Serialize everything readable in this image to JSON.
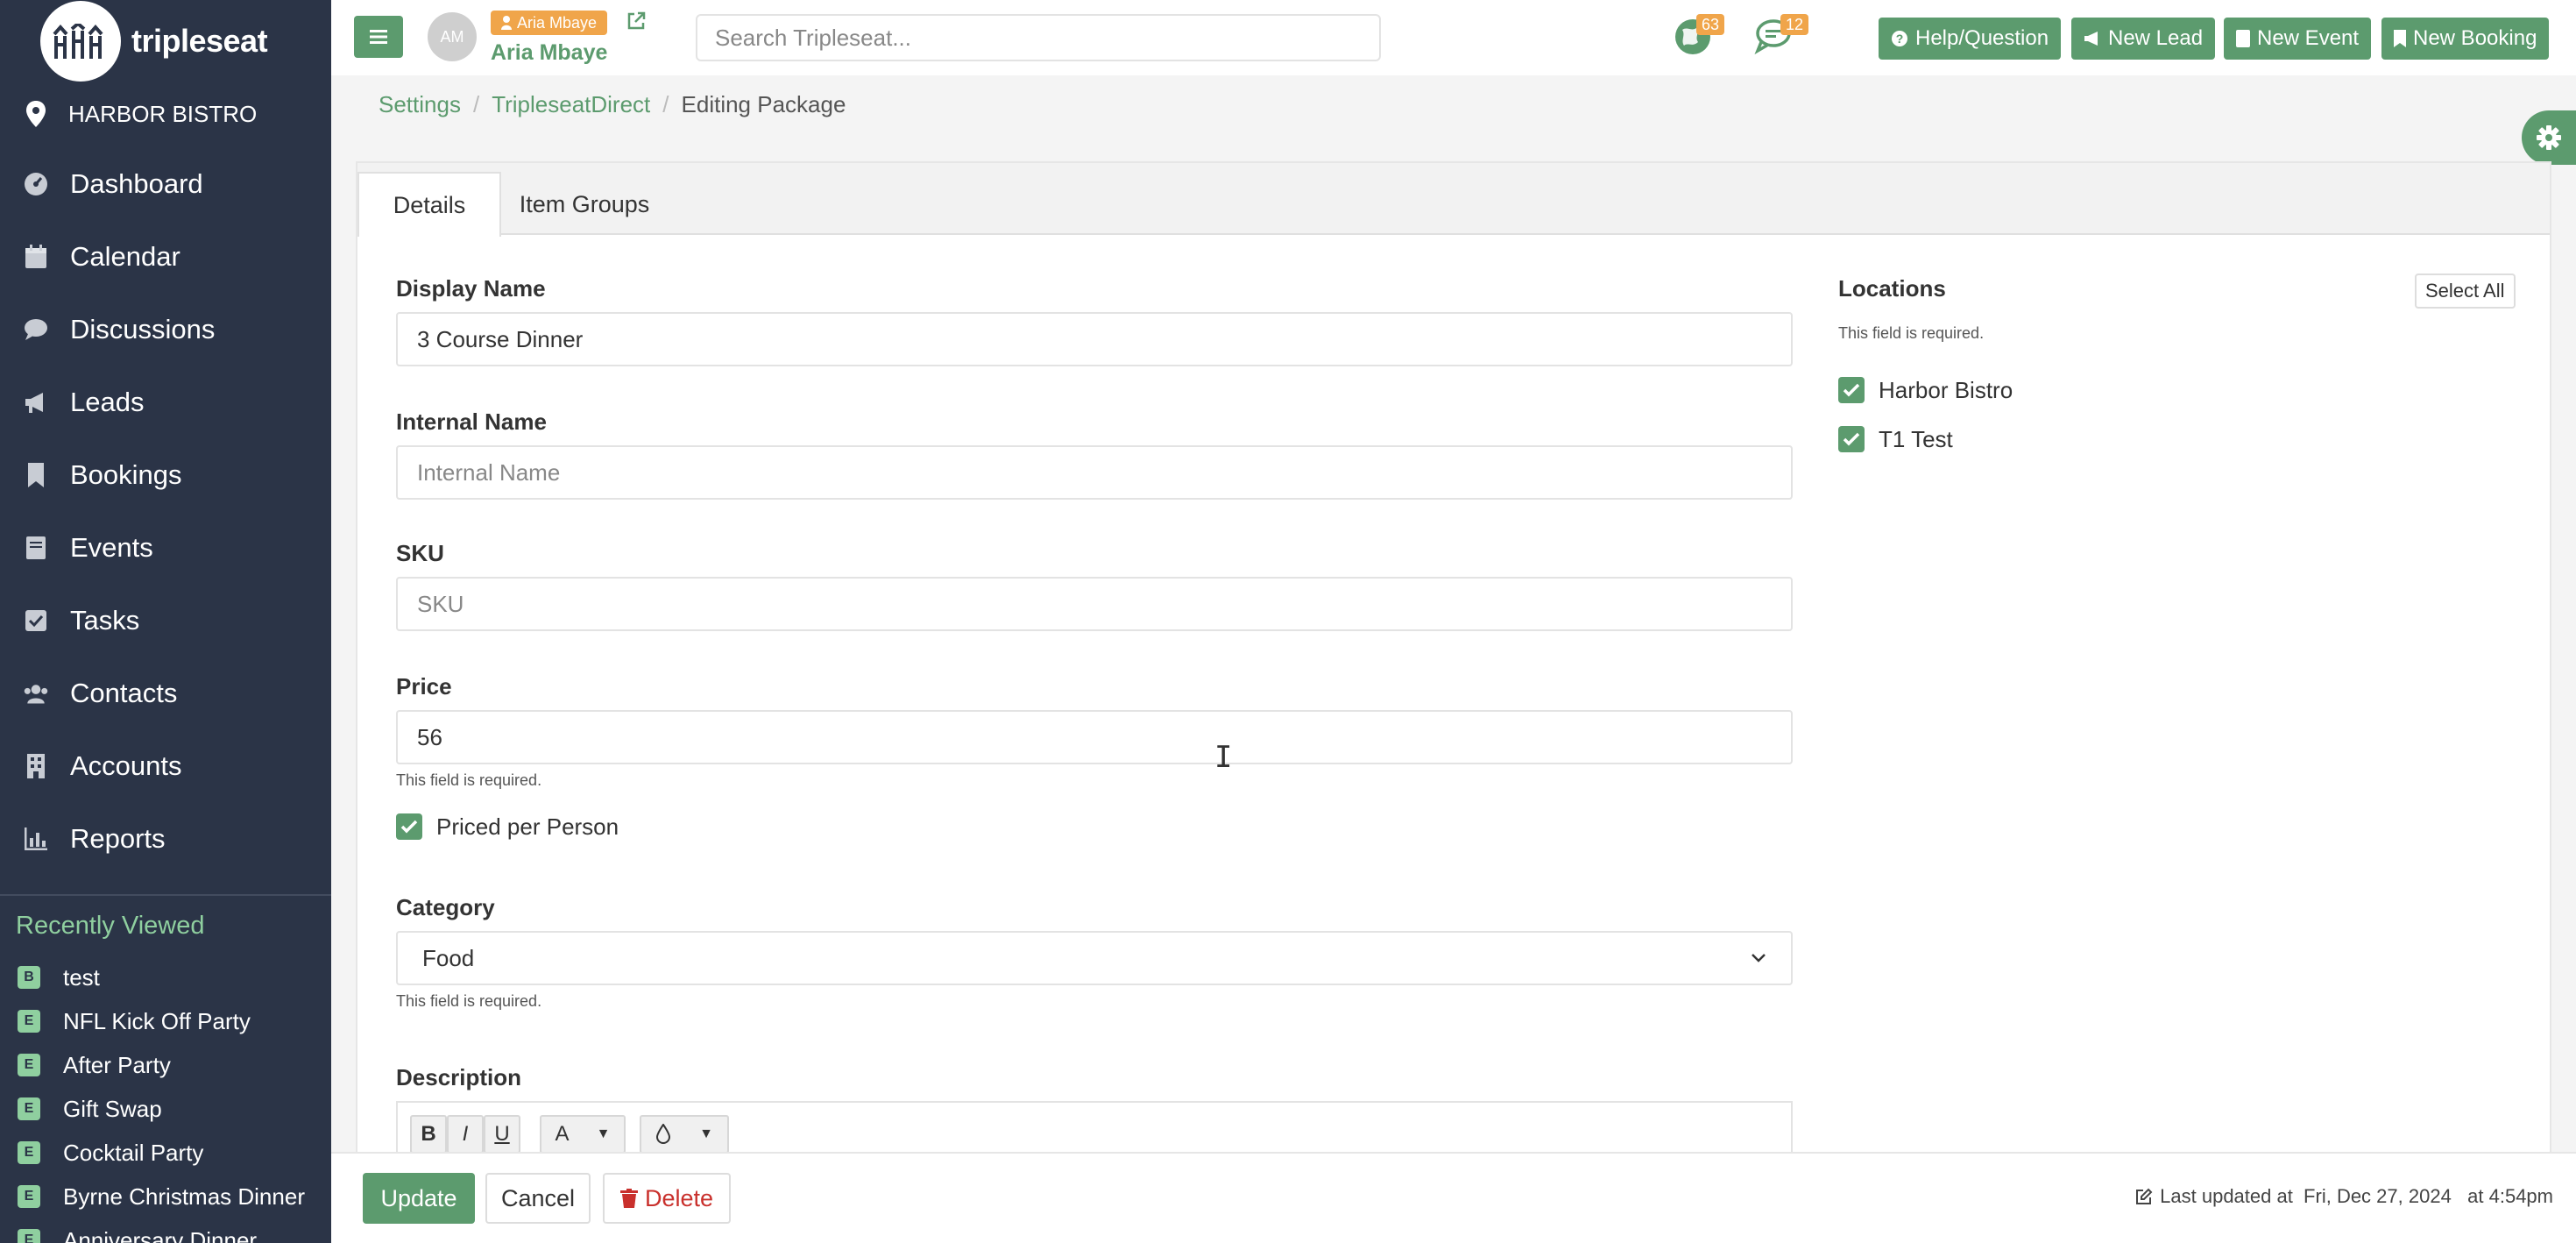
{
  "brand": {
    "name": "tripleseat"
  },
  "location": {
    "name": "HARBOR BISTRO"
  },
  "nav": {
    "items": [
      {
        "label": "Dashboard",
        "icon": "dashboard-icon"
      },
      {
        "label": "Calendar",
        "icon": "calendar-icon"
      },
      {
        "label": "Discussions",
        "icon": "chat-icon"
      },
      {
        "label": "Leads",
        "icon": "megaphone-icon"
      },
      {
        "label": "Bookings",
        "icon": "bookmark-icon"
      },
      {
        "label": "Events",
        "icon": "book-icon"
      },
      {
        "label": "Tasks",
        "icon": "check-square-icon"
      },
      {
        "label": "Contacts",
        "icon": "users-icon"
      },
      {
        "label": "Accounts",
        "icon": "building-icon"
      },
      {
        "label": "Reports",
        "icon": "bar-chart-icon"
      }
    ]
  },
  "recent": {
    "title": "Recently Viewed",
    "items": [
      {
        "badge": "B",
        "label": "test"
      },
      {
        "badge": "E",
        "label": "NFL Kick Off Party"
      },
      {
        "badge": "E",
        "label": "After Party"
      },
      {
        "badge": "E",
        "label": "Gift Swap"
      },
      {
        "badge": "E",
        "label": "Cocktail Party"
      },
      {
        "badge": "E",
        "label": "Byrne Christmas Dinner"
      },
      {
        "badge": "E",
        "label": "Anniversary Dinner"
      }
    ]
  },
  "topbar": {
    "avatar_initials": "AM",
    "user_tag": "Aria Mbaye",
    "user_name": "Aria Mbaye",
    "search_placeholder": "Search Tripleseat...",
    "notif_globe_count": "63",
    "notif_chat_count": "12",
    "help_label": "Help/Question",
    "new_lead_label": "New Lead",
    "new_event_label": "New Event",
    "new_booking_label": "New Booking"
  },
  "breadcrumb": {
    "items": [
      "Settings",
      "TripleseatDirect"
    ],
    "current": "Editing Package"
  },
  "tabs": {
    "details": "Details",
    "item_groups": "Item Groups"
  },
  "form": {
    "display_name": {
      "label": "Display Name",
      "value": "3 Course Dinner"
    },
    "internal_name": {
      "label": "Internal Name",
      "placeholder": "Internal Name"
    },
    "sku": {
      "label": "SKU",
      "placeholder": "SKU"
    },
    "price": {
      "label": "Price",
      "value": "56",
      "help": "This field is required."
    },
    "priced_per_person": {
      "label": "Priced per Person",
      "checked": true
    },
    "category": {
      "label": "Category",
      "value": "Food",
      "help": "This field is required."
    },
    "description": {
      "label": "Description"
    },
    "toolbar": {
      "bold": "B",
      "italic": "I",
      "underline": "U",
      "font": "A"
    }
  },
  "locations": {
    "title": "Locations",
    "select_all": "Select All",
    "help": "This field is required.",
    "items": [
      {
        "label": "Harbor Bistro",
        "checked": true
      },
      {
        "label": "T1 Test",
        "checked": true
      }
    ]
  },
  "footer": {
    "update": "Update",
    "cancel": "Cancel",
    "delete": "Delete",
    "last_updated": "Last updated at  Fri, Dec 27, 2024   at 4:54pm"
  },
  "colors": {
    "accent": "#5c9b6e",
    "sidebar": "#2b3447",
    "badge": "#f0a54a",
    "danger": "#c9302c"
  }
}
